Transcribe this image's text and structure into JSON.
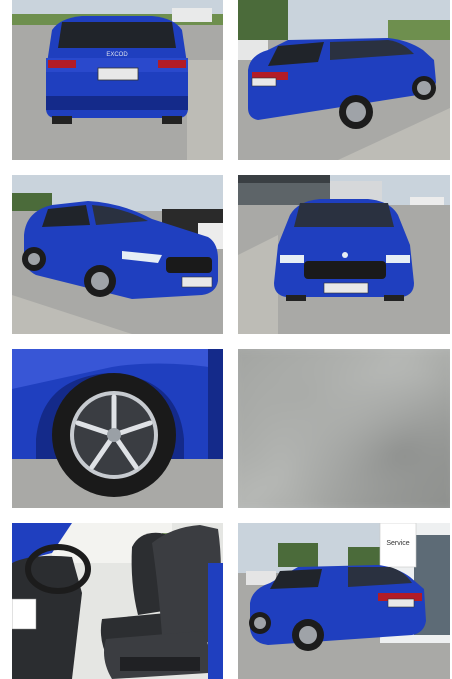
{
  "gallery": {
    "photos": [
      {
        "name": "rear",
        "plate_text": "EXCOD"
      },
      {
        "name": "rear-three-quarter"
      },
      {
        "name": "front-three-quarter"
      },
      {
        "name": "front"
      },
      {
        "name": "wheel"
      },
      {
        "name": "blurred"
      },
      {
        "name": "interior-seats"
      },
      {
        "name": "rear-three-quarter-dealer",
        "sign_text": "Service"
      }
    ],
    "colors": {
      "car_blue": "#1f3fbf",
      "car_blue_dark": "#142a8a",
      "sky": "#c9d3dc",
      "pavement": "#a9a9a6",
      "grass": "#6e8f4e"
    }
  }
}
